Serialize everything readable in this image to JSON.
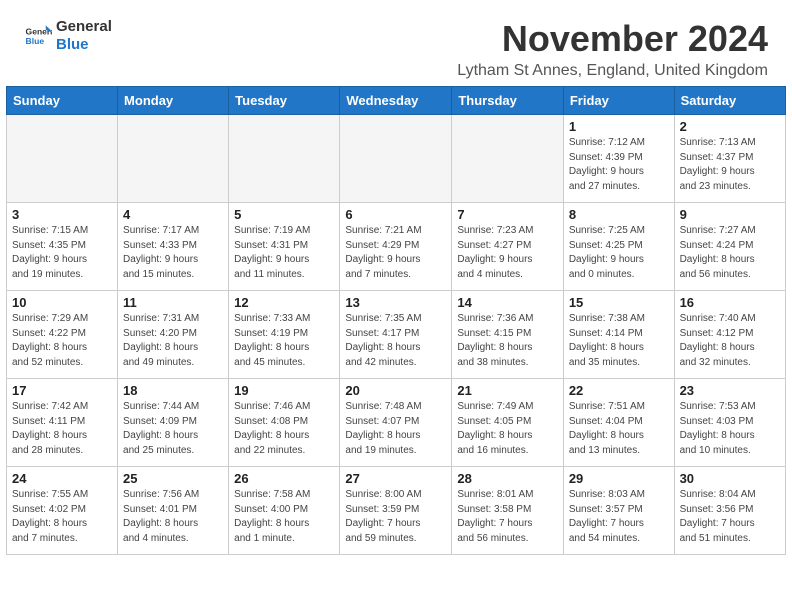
{
  "header": {
    "logo_line1": "General",
    "logo_line2": "Blue",
    "month": "November 2024",
    "location": "Lytham St Annes, England, United Kingdom"
  },
  "weekdays": [
    "Sunday",
    "Monday",
    "Tuesday",
    "Wednesday",
    "Thursday",
    "Friday",
    "Saturday"
  ],
  "weeks": [
    [
      {
        "day": "",
        "info": ""
      },
      {
        "day": "",
        "info": ""
      },
      {
        "day": "",
        "info": ""
      },
      {
        "day": "",
        "info": ""
      },
      {
        "day": "",
        "info": ""
      },
      {
        "day": "1",
        "info": "Sunrise: 7:12 AM\nSunset: 4:39 PM\nDaylight: 9 hours\nand 27 minutes."
      },
      {
        "day": "2",
        "info": "Sunrise: 7:13 AM\nSunset: 4:37 PM\nDaylight: 9 hours\nand 23 minutes."
      }
    ],
    [
      {
        "day": "3",
        "info": "Sunrise: 7:15 AM\nSunset: 4:35 PM\nDaylight: 9 hours\nand 19 minutes."
      },
      {
        "day": "4",
        "info": "Sunrise: 7:17 AM\nSunset: 4:33 PM\nDaylight: 9 hours\nand 15 minutes."
      },
      {
        "day": "5",
        "info": "Sunrise: 7:19 AM\nSunset: 4:31 PM\nDaylight: 9 hours\nand 11 minutes."
      },
      {
        "day": "6",
        "info": "Sunrise: 7:21 AM\nSunset: 4:29 PM\nDaylight: 9 hours\nand 7 minutes."
      },
      {
        "day": "7",
        "info": "Sunrise: 7:23 AM\nSunset: 4:27 PM\nDaylight: 9 hours\nand 4 minutes."
      },
      {
        "day": "8",
        "info": "Sunrise: 7:25 AM\nSunset: 4:25 PM\nDaylight: 9 hours\nand 0 minutes."
      },
      {
        "day": "9",
        "info": "Sunrise: 7:27 AM\nSunset: 4:24 PM\nDaylight: 8 hours\nand 56 minutes."
      }
    ],
    [
      {
        "day": "10",
        "info": "Sunrise: 7:29 AM\nSunset: 4:22 PM\nDaylight: 8 hours\nand 52 minutes."
      },
      {
        "day": "11",
        "info": "Sunrise: 7:31 AM\nSunset: 4:20 PM\nDaylight: 8 hours\nand 49 minutes."
      },
      {
        "day": "12",
        "info": "Sunrise: 7:33 AM\nSunset: 4:19 PM\nDaylight: 8 hours\nand 45 minutes."
      },
      {
        "day": "13",
        "info": "Sunrise: 7:35 AM\nSunset: 4:17 PM\nDaylight: 8 hours\nand 42 minutes."
      },
      {
        "day": "14",
        "info": "Sunrise: 7:36 AM\nSunset: 4:15 PM\nDaylight: 8 hours\nand 38 minutes."
      },
      {
        "day": "15",
        "info": "Sunrise: 7:38 AM\nSunset: 4:14 PM\nDaylight: 8 hours\nand 35 minutes."
      },
      {
        "day": "16",
        "info": "Sunrise: 7:40 AM\nSunset: 4:12 PM\nDaylight: 8 hours\nand 32 minutes."
      }
    ],
    [
      {
        "day": "17",
        "info": "Sunrise: 7:42 AM\nSunset: 4:11 PM\nDaylight: 8 hours\nand 28 minutes."
      },
      {
        "day": "18",
        "info": "Sunrise: 7:44 AM\nSunset: 4:09 PM\nDaylight: 8 hours\nand 25 minutes."
      },
      {
        "day": "19",
        "info": "Sunrise: 7:46 AM\nSunset: 4:08 PM\nDaylight: 8 hours\nand 22 minutes."
      },
      {
        "day": "20",
        "info": "Sunrise: 7:48 AM\nSunset: 4:07 PM\nDaylight: 8 hours\nand 19 minutes."
      },
      {
        "day": "21",
        "info": "Sunrise: 7:49 AM\nSunset: 4:05 PM\nDaylight: 8 hours\nand 16 minutes."
      },
      {
        "day": "22",
        "info": "Sunrise: 7:51 AM\nSunset: 4:04 PM\nDaylight: 8 hours\nand 13 minutes."
      },
      {
        "day": "23",
        "info": "Sunrise: 7:53 AM\nSunset: 4:03 PM\nDaylight: 8 hours\nand 10 minutes."
      }
    ],
    [
      {
        "day": "24",
        "info": "Sunrise: 7:55 AM\nSunset: 4:02 PM\nDaylight: 8 hours\nand 7 minutes."
      },
      {
        "day": "25",
        "info": "Sunrise: 7:56 AM\nSunset: 4:01 PM\nDaylight: 8 hours\nand 4 minutes."
      },
      {
        "day": "26",
        "info": "Sunrise: 7:58 AM\nSunset: 4:00 PM\nDaylight: 8 hours\nand 1 minute."
      },
      {
        "day": "27",
        "info": "Sunrise: 8:00 AM\nSunset: 3:59 PM\nDaylight: 7 hours\nand 59 minutes."
      },
      {
        "day": "28",
        "info": "Sunrise: 8:01 AM\nSunset: 3:58 PM\nDaylight: 7 hours\nand 56 minutes."
      },
      {
        "day": "29",
        "info": "Sunrise: 8:03 AM\nSunset: 3:57 PM\nDaylight: 7 hours\nand 54 minutes."
      },
      {
        "day": "30",
        "info": "Sunrise: 8:04 AM\nSunset: 3:56 PM\nDaylight: 7 hours\nand 51 minutes."
      }
    ]
  ]
}
